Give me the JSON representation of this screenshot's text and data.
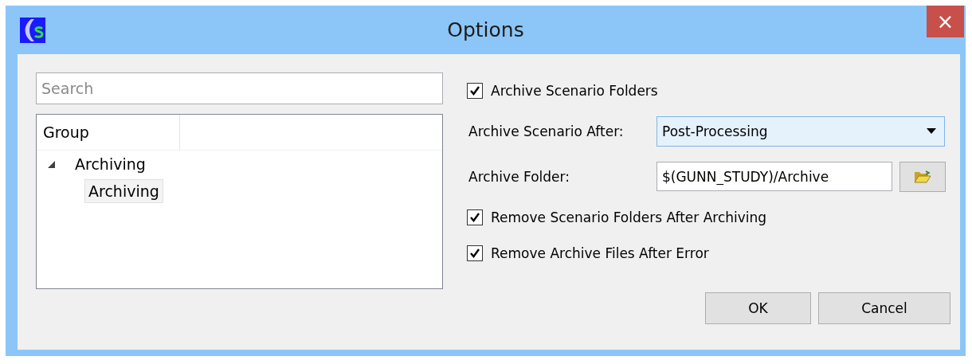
{
  "window": {
    "title": "Options",
    "close": "×"
  },
  "search": {
    "placeholder": "Search"
  },
  "tree": {
    "columns": [
      "Group"
    ],
    "items": [
      {
        "label": "Archiving",
        "expanded": true,
        "selected": false,
        "children": [
          {
            "label": "Archiving",
            "selected": true
          }
        ]
      }
    ]
  },
  "options": [
    {
      "kind": "checkbox",
      "label": "Archive Scenario Folders",
      "checked": true
    },
    {
      "kind": "combo",
      "label": "Archive Scenario After:",
      "value": "Post-Processing",
      "focused": true
    },
    {
      "kind": "folder",
      "label": "Archive Folder:",
      "value": "$(GUNN_STUDY)/Archive"
    },
    {
      "kind": "checkbox",
      "label": "Remove Scenario Folders After Archiving",
      "checked": true
    },
    {
      "kind": "checkbox",
      "label": "Remove Archive Files After Error",
      "checked": true
    }
  ],
  "buttons": [
    "OK",
    "Cancel"
  ]
}
